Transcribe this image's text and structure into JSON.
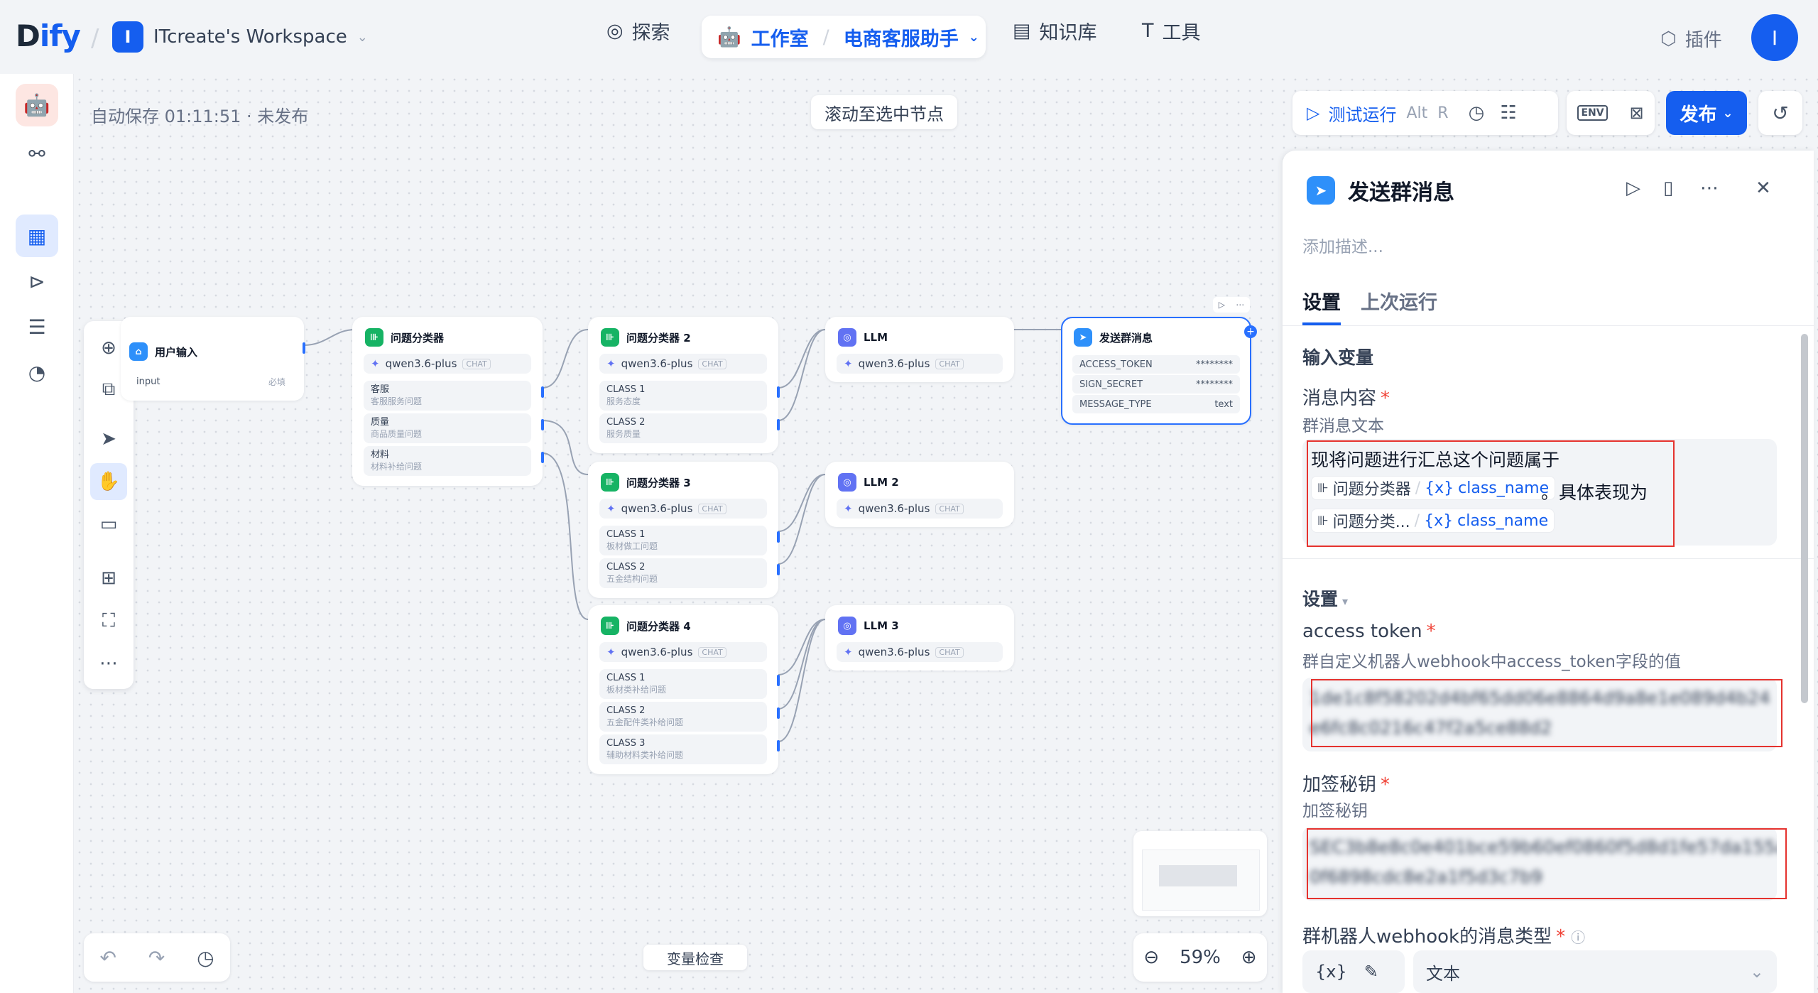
{
  "app": {
    "logo_d": "D",
    "logo_rest": "ify",
    "workspace_initial": "I",
    "workspace": "ITcreate's Workspace",
    "user_initial": "I",
    "plugin": "插件"
  },
  "nav": {
    "explore": "探索",
    "studio": "工作室",
    "app_name": "电商客服助手",
    "knowledge": "知识库",
    "tools": "工具"
  },
  "canvas": {
    "autosave": "自动保存 01:11:51 · 未发布",
    "scroll_to_selected": "滚动至选中节点",
    "test_run": "测试运行",
    "shortcut_alt": "Alt",
    "shortcut_r": "R",
    "env": "ENV",
    "publish": "发布",
    "var_check": "变量检查",
    "zoom": "59%"
  },
  "nodes": {
    "start": {
      "title": "用户输入",
      "var": "input",
      "required": "必填"
    },
    "c1": {
      "title": "问题分类器",
      "model": "qwen3.6-plus",
      "chat": "CHAT",
      "classes": [
        {
          "name": "客服",
          "desc": "客服服务问题"
        },
        {
          "name": "质量",
          "desc": "商品质量问题"
        },
        {
          "name": "材料",
          "desc": "材料补给问题"
        }
      ]
    },
    "c2": {
      "title": "问题分类器 2",
      "model": "qwen3.6-plus",
      "chat": "CHAT",
      "classes": [
        {
          "name": "CLASS 1",
          "desc": "服务态度"
        },
        {
          "name": "CLASS 2",
          "desc": "服务质量"
        }
      ]
    },
    "c3": {
      "title": "问题分类器 3",
      "model": "qwen3.6-plus",
      "chat": "CHAT",
      "classes": [
        {
          "name": "CLASS 1",
          "desc": "板材做工问题"
        },
        {
          "name": "CLASS 2",
          "desc": "五金结构问题"
        }
      ]
    },
    "c4": {
      "title": "问题分类器 4",
      "model": "qwen3.6-plus",
      "chat": "CHAT",
      "classes": [
        {
          "name": "CLASS 1",
          "desc": "板材类补给问题"
        },
        {
          "name": "CLASS 2",
          "desc": "五金配件类补给问题"
        },
        {
          "name": "CLASS 3",
          "desc": "辅助材料类补给问题"
        }
      ]
    },
    "llm1": {
      "title": "LLM",
      "model": "qwen3.6-plus",
      "chat": "CHAT"
    },
    "llm2": {
      "title": "LLM 2",
      "model": "qwen3.6-plus",
      "chat": "CHAT"
    },
    "llm3": {
      "title": "LLM 3",
      "model": "qwen3.6-plus",
      "chat": "CHAT"
    },
    "send": {
      "title": "发送群消息",
      "vars": [
        {
          "name": "ACCESS_TOKEN",
          "value": "********"
        },
        {
          "name": "SIGN_SECRET",
          "value": "********"
        },
        {
          "name": "MESSAGE_TYPE",
          "value": "text"
        }
      ]
    }
  },
  "panel": {
    "title": "发送群消息",
    "desc_placeholder": "添加描述...",
    "tab_settings": "设置",
    "tab_last_run": "上次运行",
    "input_vars": "输入变量",
    "msg_label": "消息内容",
    "msg_desc": "群消息文本",
    "msg_line1": "现将问题进行汇总这个问题属于",
    "chip1_node": "问题分类器",
    "chip1_var": "class_name",
    "msg_mid": "。具体表现为",
    "chip2_node": "问题分类...",
    "chip2_var": "class_name",
    "settings": "设置",
    "token_label": "access token",
    "token_desc": "群自定义机器人webhook中access_token字段的值",
    "token_line1": "1de1c8f58202d4bf65dd06e8864d9a8e1e089d4b24",
    "token_line2": "e6fc8c0216c47f2a5ce88d2",
    "secret_label": "加签秘钥",
    "secret_desc": "加签秘钥",
    "secret_line1": "SEC3b8e8c0e401bce59b60ef0860f5d8d1fe57da155a",
    "secret_line2": "0f6898cdc8e2a1f5d3c7b9",
    "msgtype_label": "群机器人webhook的消息类型",
    "msgtype_value": "文本"
  }
}
